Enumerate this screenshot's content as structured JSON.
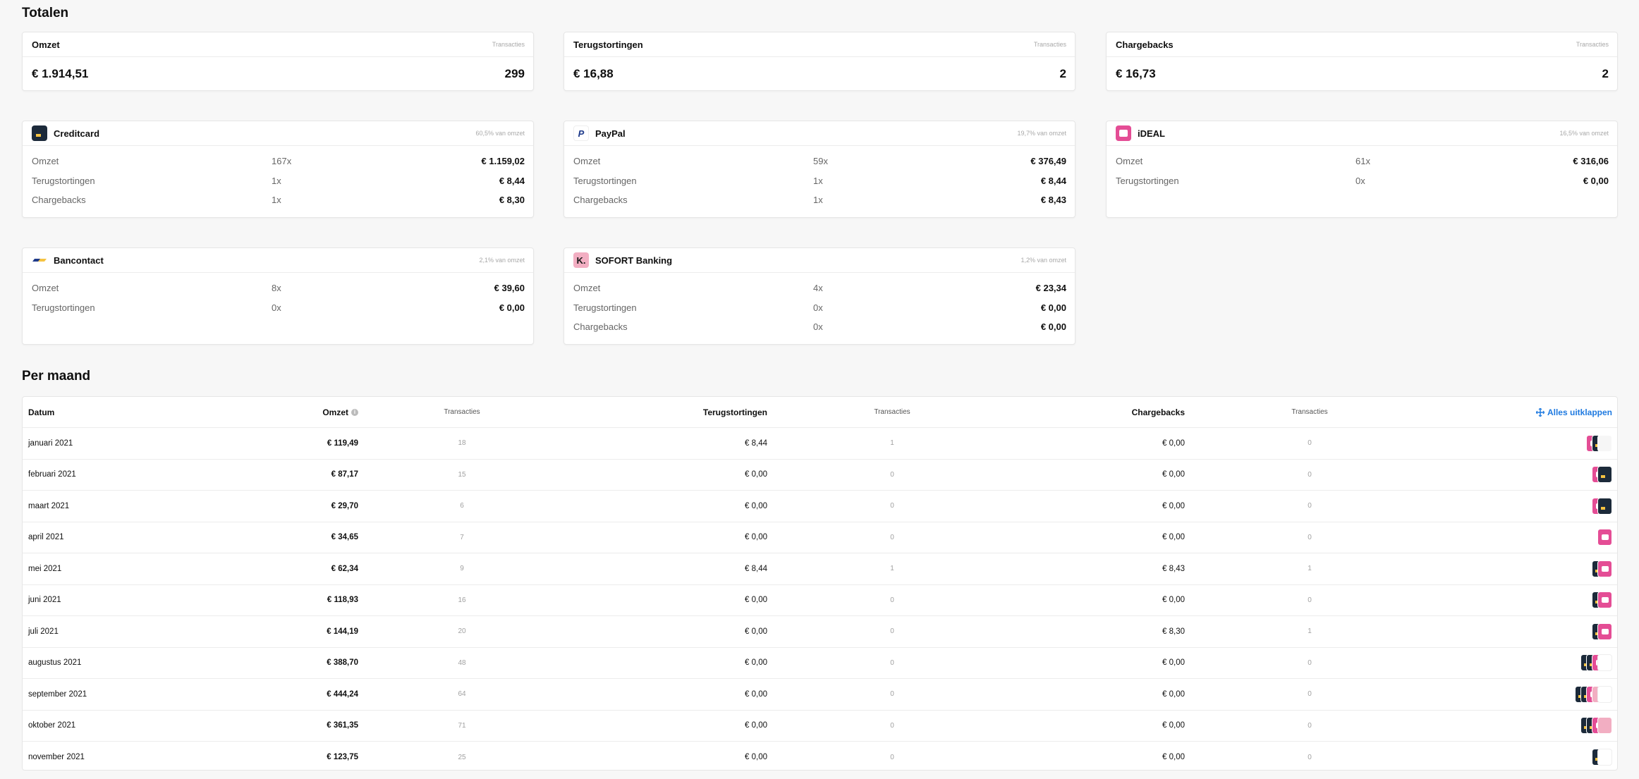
{
  "totals": {
    "title": "Totalen",
    "cards": [
      {
        "label": "Omzet",
        "meta": "Transacties",
        "amount": "€ 1.914,51",
        "count": "299"
      },
      {
        "label": "Terugstortingen",
        "meta": "Transacties",
        "amount": "€ 16,88",
        "count": "2"
      },
      {
        "label": "Chargebacks",
        "meta": "Transacties",
        "amount": "€ 16,73",
        "count": "2"
      }
    ]
  },
  "methods": [
    {
      "name": "Creditcard",
      "icon": "creditcard-icon",
      "share": "60,5% van omzet",
      "rows": [
        {
          "label": "Omzet",
          "count": "167x",
          "amount": "€ 1.159,02"
        },
        {
          "label": "Terugstortingen",
          "count": "1x",
          "amount": "€ 8,44"
        },
        {
          "label": "Chargebacks",
          "count": "1x",
          "amount": "€ 8,30"
        }
      ]
    },
    {
      "name": "PayPal",
      "icon": "paypal-icon",
      "share": "19,7% van omzet",
      "rows": [
        {
          "label": "Omzet",
          "count": "59x",
          "amount": "€ 376,49"
        },
        {
          "label": "Terugstortingen",
          "count": "1x",
          "amount": "€ 8,44"
        },
        {
          "label": "Chargebacks",
          "count": "1x",
          "amount": "€ 8,43"
        }
      ]
    },
    {
      "name": "iDEAL",
      "icon": "ideal-icon",
      "share": "16,5% van omzet",
      "rows": [
        {
          "label": "Omzet",
          "count": "61x",
          "amount": "€ 316,06"
        },
        {
          "label": "Terugstortingen",
          "count": "0x",
          "amount": "€ 0,00"
        }
      ]
    },
    {
      "name": "Bancontact",
      "icon": "bancontact-icon",
      "share": "2,1% van omzet",
      "rows": [
        {
          "label": "Omzet",
          "count": "8x",
          "amount": "€ 39,60"
        },
        {
          "label": "Terugstortingen",
          "count": "0x",
          "amount": "€ 0,00"
        }
      ]
    },
    {
      "name": "SOFORT Banking",
      "icon": "sofort-icon",
      "share": "1,2% van omzet",
      "icon_letter": "K.",
      "rows": [
        {
          "label": "Omzet",
          "count": "4x",
          "amount": "€ 23,34"
        },
        {
          "label": "Terugstortingen",
          "count": "0x",
          "amount": "€ 0,00"
        },
        {
          "label": "Chargebacks",
          "count": "0x",
          "amount": "€ 0,00"
        }
      ]
    }
  ],
  "monthly": {
    "title": "Per maand",
    "headers": {
      "date": "Datum",
      "revenue": "Omzet",
      "tx1": "Transacties",
      "refunds": "Terugstortingen",
      "tx2": "Transacties",
      "chargebacks": "Chargebacks",
      "tx3": "Transacties",
      "expand": "Alles uitklappen"
    },
    "rows": [
      {
        "date": "januari 2021",
        "revenue": "€ 119,49",
        "tx1": "18",
        "refunds": "€ 8,44",
        "tx2": "1",
        "chargebacks": "€ 0,00",
        "tx3": "0",
        "methods": [
          "ideal",
          "cc",
          "pp"
        ]
      },
      {
        "date": "februari 2021",
        "revenue": "€ 87,17",
        "tx1": "15",
        "refunds": "€ 0,00",
        "tx2": "0",
        "chargebacks": "€ 0,00",
        "tx3": "0",
        "methods": [
          "ideal",
          "cc"
        ]
      },
      {
        "date": "maart 2021",
        "revenue": "€ 29,70",
        "tx1": "6",
        "refunds": "€ 0,00",
        "tx2": "0",
        "chargebacks": "€ 0,00",
        "tx3": "0",
        "methods": [
          "ideal",
          "cc"
        ]
      },
      {
        "date": "april 2021",
        "revenue": "€ 34,65",
        "tx1": "7",
        "refunds": "€ 0,00",
        "tx2": "0",
        "chargebacks": "€ 0,00",
        "tx3": "0",
        "methods": [
          "ideal"
        ]
      },
      {
        "date": "mei 2021",
        "revenue": "€ 62,34",
        "tx1": "9",
        "refunds": "€ 8,44",
        "tx2": "1",
        "chargebacks": "€ 8,43",
        "tx3": "1",
        "methods": [
          "cc",
          "ideal"
        ]
      },
      {
        "date": "juni 2021",
        "revenue": "€ 118,93",
        "tx1": "16",
        "refunds": "€ 0,00",
        "tx2": "0",
        "chargebacks": "€ 0,00",
        "tx3": "0",
        "methods": [
          "cc",
          "ideal"
        ]
      },
      {
        "date": "juli 2021",
        "revenue": "€ 144,19",
        "tx1": "20",
        "refunds": "€ 0,00",
        "tx2": "0",
        "chargebacks": "€ 8,30",
        "tx3": "1",
        "methods": [
          "cc",
          "ideal"
        ]
      },
      {
        "date": "augustus 2021",
        "revenue": "€ 388,70",
        "tx1": "48",
        "refunds": "€ 0,00",
        "tx2": "0",
        "chargebacks": "€ 0,00",
        "tx3": "0",
        "methods": [
          "cc",
          "cc",
          "ideal",
          "bc"
        ]
      },
      {
        "date": "september 2021",
        "revenue": "€ 444,24",
        "tx1": "64",
        "refunds": "€ 0,00",
        "tx2": "0",
        "chargebacks": "€ 0,00",
        "tx3": "0",
        "methods": [
          "cc",
          "cc",
          "ideal",
          "sofort",
          "bc"
        ]
      },
      {
        "date": "oktober 2021",
        "revenue": "€ 361,35",
        "tx1": "71",
        "refunds": "€ 0,00",
        "tx2": "0",
        "chargebacks": "€ 0,00",
        "tx3": "0",
        "methods": [
          "cc",
          "cc",
          "ideal",
          "sofort"
        ]
      },
      {
        "date": "november 2021",
        "revenue": "€ 123,75",
        "tx1": "25",
        "refunds": "€ 0,00",
        "tx2": "0",
        "chargebacks": "€ 0,00",
        "tx3": "0",
        "methods": [
          "cc",
          "bc"
        ]
      }
    ]
  }
}
